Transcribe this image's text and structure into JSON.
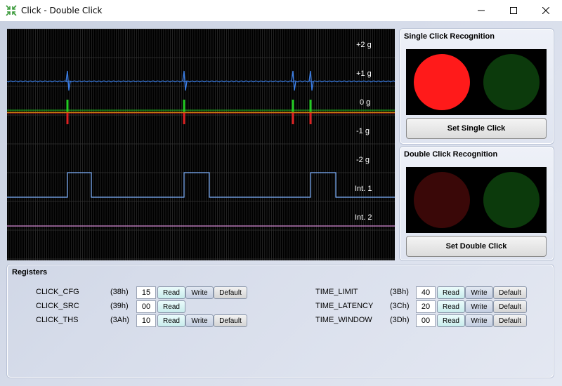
{
  "window": {
    "title": "Click - Double Click",
    "icon": "click-app-icon"
  },
  "scope": {
    "labels": [
      "+2 g",
      "+1 g",
      "0 g",
      "-1 g",
      "-2 g",
      "Int. 1",
      "Int. 2"
    ],
    "colors": {
      "x_axis": "#3a7be0",
      "y_axis": "#22cc22",
      "z_axis": "#dd2222",
      "zero_line": "#c8c800",
      "int1": "#7fb2ff",
      "int2": "#d58ad5"
    }
  },
  "single_click": {
    "title": "Single Click Recognition",
    "button": "Set Single Click",
    "leds": [
      {
        "name": "single-click-led-1",
        "color": "#ff1a1a"
      },
      {
        "name": "single-click-led-2",
        "color": "#0c3a0c"
      }
    ]
  },
  "double_click": {
    "title": "Double Click Recognition",
    "button": "Set Double Click",
    "leds": [
      {
        "name": "double-click-led-1",
        "color": "#3a0808"
      },
      {
        "name": "double-click-led-2",
        "color": "#0c3a0c"
      }
    ]
  },
  "registers": {
    "title": "Registers",
    "read": "Read",
    "write": "Write",
    "default": "Default",
    "left": [
      {
        "name": "CLICK_CFG",
        "addr": "(38h)",
        "value": "15",
        "writable": true
      },
      {
        "name": "CLICK_SRC",
        "addr": "(39h)",
        "value": "00",
        "writable": false
      },
      {
        "name": "CLICK_THS",
        "addr": "(3Ah)",
        "value": "10",
        "writable": true
      }
    ],
    "right": [
      {
        "name": "TIME_LIMIT",
        "addr": "(3Bh)",
        "value": "40",
        "writable": true
      },
      {
        "name": "TIME_LATENCY",
        "addr": "(3Ch)",
        "value": "20",
        "writable": true
      },
      {
        "name": "TIME_WINDOW",
        "addr": "(3Dh)",
        "value": "00",
        "writable": true
      }
    ]
  }
}
